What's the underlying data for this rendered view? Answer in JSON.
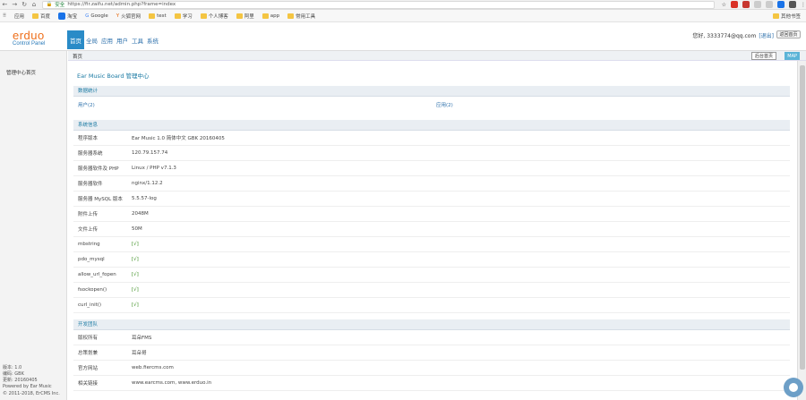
{
  "browser": {
    "secure_label": "安全",
    "url": "https://fir.zaifu.net/admin.php?frame=index",
    "bookmarks": [
      "应用",
      "百度",
      "淘宝",
      "Google",
      "火狐官网",
      "test",
      "学习",
      "个人博客",
      "阿里",
      "app",
      "常用工具"
    ],
    "bookmark_right": "其他书签",
    "colors": {
      "ext_red": "#d93025",
      "ext_blue": "#1a73e8",
      "folder": "#f4c542"
    }
  },
  "header": {
    "logo": "erduo",
    "logo_sub": "Control Panel",
    "nav": [
      "首页",
      "全局",
      "应用",
      "用户",
      "工具",
      "系统"
    ],
    "user_text": "您好, 3333774@qq.com",
    "user_link": "[退出]",
    "logout_label": "返回首页"
  },
  "sidebar": {
    "item": "管理中心首页",
    "footer": [
      "版本: 1.0",
      "编码: GBK",
      "更新: 20160405",
      "Powered by Ear Music",
      "© 2011-2018, ErCMS Inc."
    ]
  },
  "crumb": {
    "label": "首页",
    "button": "后台首页",
    "map": "MAP"
  },
  "main": {
    "title": "Ear Music Board 管理中心",
    "stats_head": "数据统计",
    "stats": [
      "用户(2)",
      "应用(2)"
    ],
    "sys_head": "系统信息",
    "sys_rows": [
      {
        "label": "程序版本",
        "value": "Ear Music 1.0 简体中文 GBK 20160405",
        "ok": false
      },
      {
        "label": "服务器系统",
        "value": "120.79.157.74",
        "ok": false
      },
      {
        "label": "服务器软件及 PHP",
        "value": "Linux / PHP v7.1.3",
        "ok": false
      },
      {
        "label": "服务器软件",
        "value": "nginx/1.12.2",
        "ok": false
      },
      {
        "label": "服务器 MySQL 版本",
        "value": "5.5.57-log",
        "ok": false
      },
      {
        "label": "附件上传",
        "value": "2048M",
        "ok": false
      },
      {
        "label": "文件上传",
        "value": "50M",
        "ok": false
      },
      {
        "label": "mbstring",
        "value": "[√]",
        "ok": true
      },
      {
        "label": "pdo_mysql",
        "value": "[√]",
        "ok": true
      },
      {
        "label": "allow_url_fopen",
        "value": "[√]",
        "ok": true
      },
      {
        "label": "fsockopen()",
        "value": "[√]",
        "ok": true
      },
      {
        "label": "curl_init()",
        "value": "[√]",
        "ok": true
      }
    ],
    "team_head": "开发团队",
    "team_rows": [
      {
        "label": "版权所有",
        "value": "耳朵FMS"
      },
      {
        "label": "总策划兼",
        "value": "耳朵哥"
      },
      {
        "label": "官方网站",
        "value": "web.fiercms.com"
      },
      {
        "label": "相关链接",
        "value": "www.earcms.com, www.erduo.in"
      }
    ]
  }
}
